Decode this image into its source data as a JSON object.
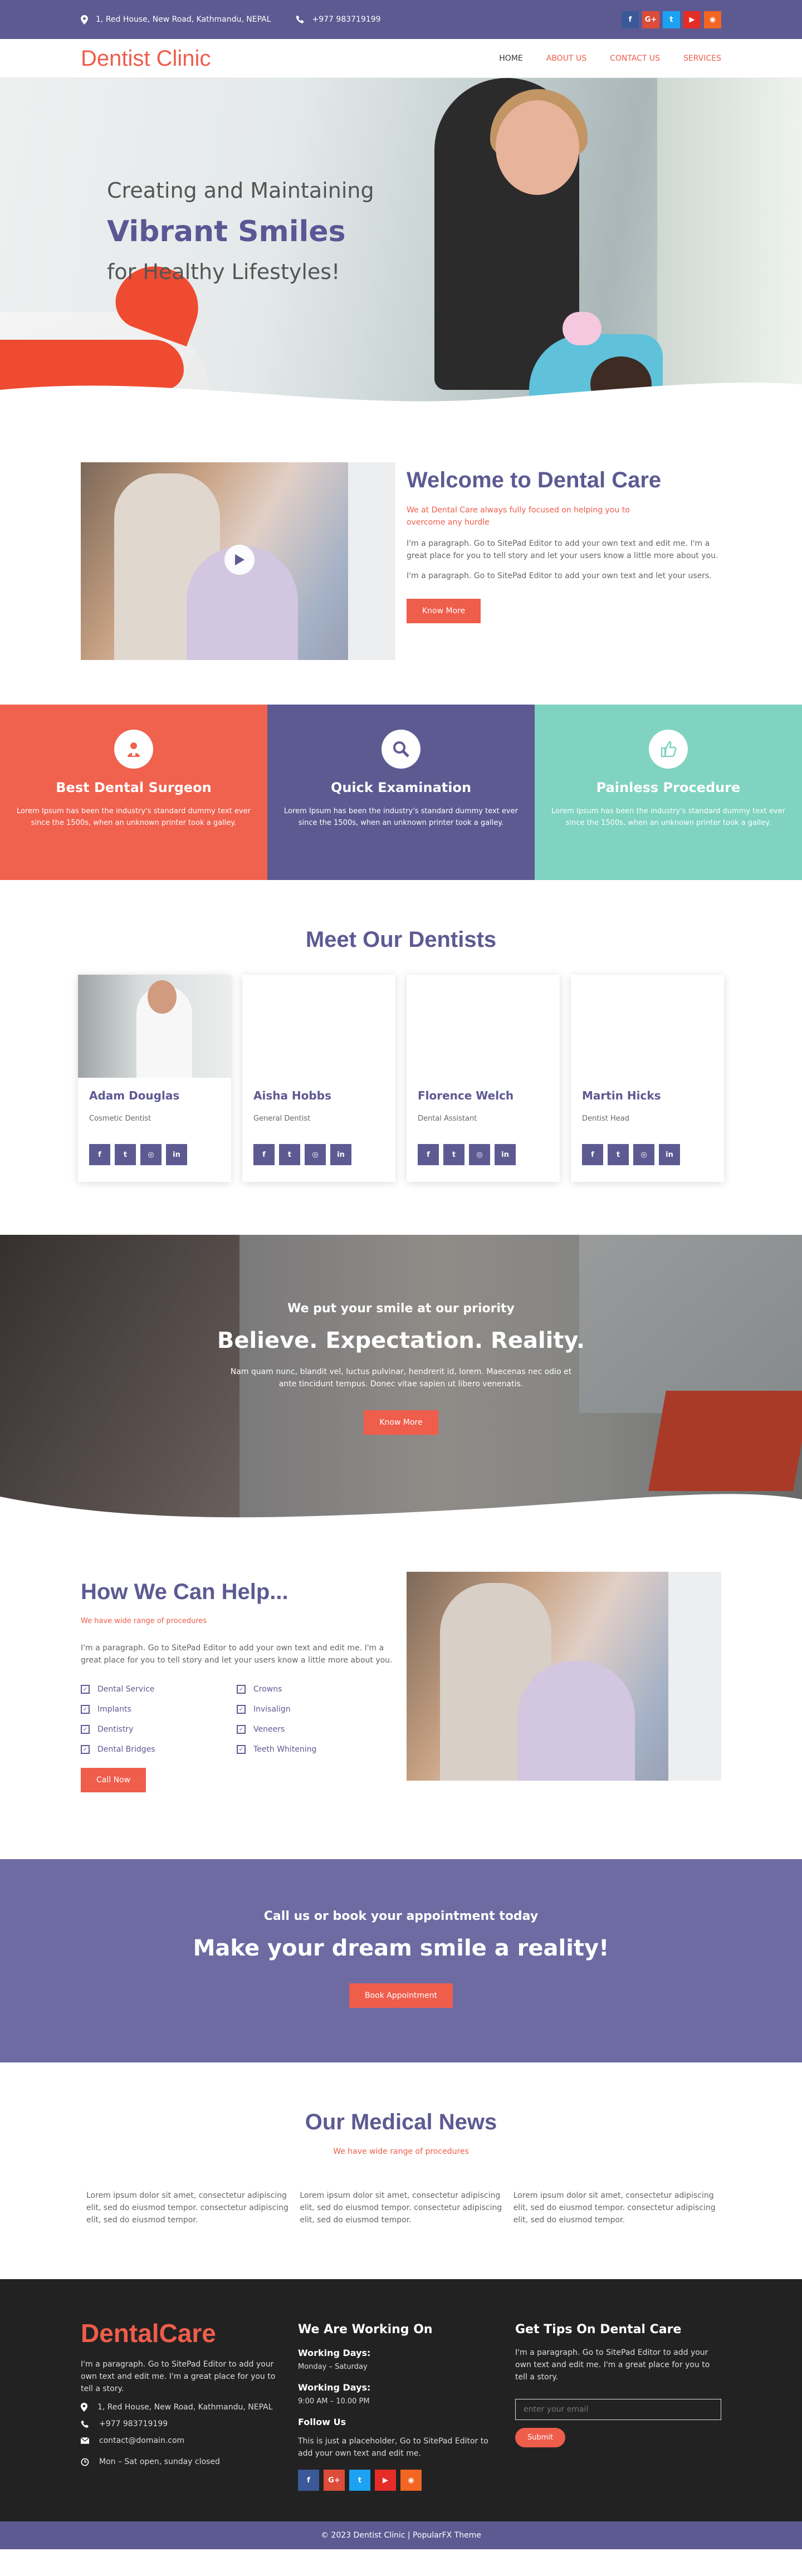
{
  "topbar": {
    "address": "1, Red House, New Road, Kathmandu, NEPAL",
    "phone": "+977 983719199",
    "social": [
      {
        "name": "facebook",
        "glyph": "f",
        "color": "#3b5998"
      },
      {
        "name": "google-plus",
        "glyph": "G+",
        "color": "#dd4b39"
      },
      {
        "name": "twitter",
        "glyph": "t",
        "color": "#1da1f2"
      },
      {
        "name": "youtube",
        "glyph": "▶",
        "color": "#e52d27"
      },
      {
        "name": "rss",
        "glyph": "◉",
        "color": "#f26522"
      }
    ]
  },
  "header": {
    "logo": "Dentist Clinic",
    "nav": [
      "HOME",
      "ABOUT US",
      "CONTACT US",
      "SERVICES"
    ]
  },
  "hero": {
    "line1": "Creating and Maintaining",
    "line2": "Vibrant Smiles",
    "line3": "for Healthy Lifestyles!"
  },
  "welcome": {
    "title": "Welcome to Dental Care",
    "subtitle": "We at Dental Care always fully focused on helping you to overcome any hurdle",
    "p1": "I'm a paragraph. Go to SitePad Editor to add your own text and edit me. I'm a great place for you to tell story and let your users know a little more about you.",
    "p2": "I'm a paragraph. Go to SitePad Editor to add your own text and let your users.",
    "button": "Know More"
  },
  "features": [
    {
      "title": "Best Dental Surgeon",
      "text": "Lorem Ipsum has been the industry's standard dummy text ever since the 1500s, when an unknown printer took a galley.",
      "color": "#f0614e",
      "icon": "surgeon-icon"
    },
    {
      "title": "Quick Examination",
      "text": "Lorem Ipsum has been the industry's standard dummy text ever since the 1500s, when an unknown printer took a galley.",
      "color": "#5d5a92",
      "icon": "search-icon"
    },
    {
      "title": "Painless Procedure",
      "text": "Lorem Ipsum has been the industry's standard dummy text ever since the 1500s, when an unknown printer took a galley.",
      "color": "#7fd3c0",
      "icon": "thumbs-up-icon"
    }
  ],
  "dentists": {
    "title": "Meet Our Dentists",
    "members": [
      {
        "name": "Adam Douglas",
        "role": "Cosmetic Dentist"
      },
      {
        "name": "Aisha Hobbs",
        "role": "General Dentist"
      },
      {
        "name": "Florence Welch",
        "role": "Dental Assistant"
      },
      {
        "name": "Martin Hicks",
        "role": "Dentist Head"
      }
    ]
  },
  "banner": {
    "tagline": "We put your smile at our priority",
    "title": "Believe. Expectation. Reality.",
    "text": "Nam quam nunc, blandit vel, luctus pulvinar, hendrerit id, lorem. Maecenas nec odio et ante tincidunt tempus. Donec vitae sapien ut libero venenatis.",
    "button": "Know More"
  },
  "help": {
    "title": "How We Can Help...",
    "subtitle": "We have wide range of procedures",
    "text": "I'm a paragraph. Go to SitePad Editor to add your own text and edit me. I'm a great place for you to tell story and let your users know a little more about you.",
    "services": [
      "Dental Service",
      "Crowns",
      "Implants",
      "Invisalign",
      "Dentistry",
      "Veneers",
      "Dental Bridges",
      "Teeth Whitening"
    ],
    "button": "Call Now"
  },
  "appointment": {
    "tagline": "Call us or book your appointment today",
    "title": "Make your dream smile a reality!",
    "button": "Book Appointment"
  },
  "news": {
    "title": "Our Medical News",
    "subtitle": "We have wide range of procedures",
    "items": [
      "Lorem ipsum dolor sit amet, consectetur adipiscing elit, sed do eiusmod tempor. consectetur adipiscing elit, sed do eiusmod tempor.",
      "Lorem ipsum dolor sit amet, consectetur adipiscing elit, sed do eiusmod tempor. consectetur adipiscing elit, sed do eiusmod tempor.",
      "Lorem ipsum dolor sit amet, consectetur adipiscing elit, sed do eiusmod tempor. consectetur adipiscing elit, sed do eiusmod tempor."
    ]
  },
  "footer": {
    "logo": "DentalCare",
    "about": "I'm a paragraph. Go to SitePad Editor to add your own text and edit me. I'm a great place for you to tell a story.",
    "address": "1, Red House, New Road, Kathmandu, NEPAL",
    "phone": "+977 983719199",
    "email": "contact@domain.com",
    "hours": "Mon – Sat open, sunday closed",
    "working_title": "We Are Working On",
    "wd1_label": "Working Days:",
    "wd1_value": "Monday – Saturday",
    "wd2_label": "Working Days:",
    "wd2_value": "9:00 AM – 10.00 PM",
    "follow_title": "Follow Us",
    "follow_text": "This is just a placeholder, Go to SitePad Editor to add your own text and edit me.",
    "tips_title": "Get Tips On Dental Care",
    "tips_text": "I'm a paragraph. Go to SitePad Editor to add your own text and edit me. I'm a great place for you to tell a story.",
    "email_placeholder": "enter your email",
    "submit": "Submit"
  },
  "copyright": "© 2023 Dentist Clinic | PopularFX Theme",
  "colors": {
    "primary": "#5d5a92",
    "accent": "#ef5d4b",
    "mint": "#7fd3c0",
    "footer": "#222222"
  }
}
